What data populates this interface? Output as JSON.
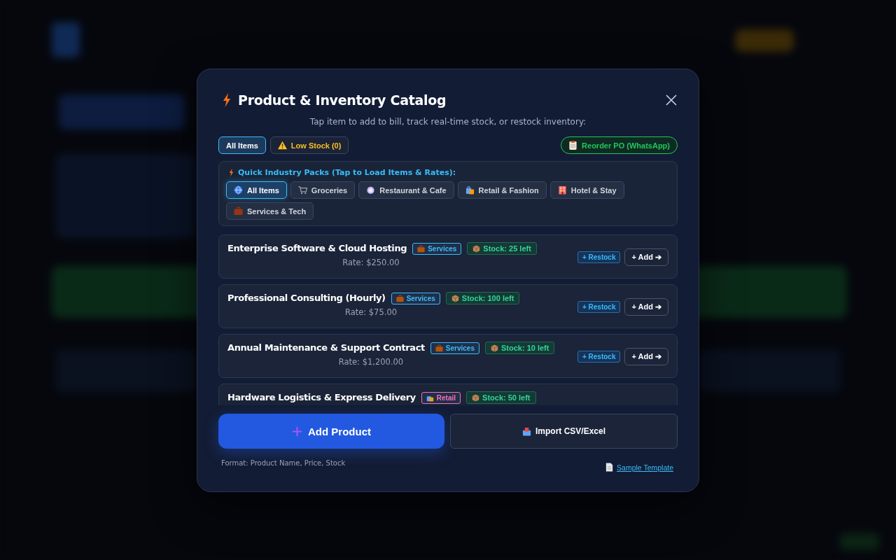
{
  "modal": {
    "title": "Product & Inventory Catalog",
    "subtitle": "Tap item to add to bill, track real-time stock, or restock inventory:"
  },
  "filters": [
    {
      "label": "All Items",
      "kind": "all",
      "selected": true
    },
    {
      "label": "Low Stock (0)",
      "kind": "low",
      "selected": false
    }
  ],
  "reorder_button": "Reorder PO (WhatsApp)",
  "packs": {
    "heading": "Quick Industry Packs (Tap to Load Items & Rates):",
    "items": [
      {
        "label": "All Items",
        "kind": "globe",
        "selected": true
      },
      {
        "label": "Groceries",
        "kind": "cart",
        "selected": false
      },
      {
        "label": "Restaurant & Cafe",
        "kind": "plate",
        "selected": false
      },
      {
        "label": "Retail & Fashion",
        "kind": "bags",
        "selected": false
      },
      {
        "label": "Hotel & Stay",
        "kind": "hotel",
        "selected": false
      },
      {
        "label": "Services & Tech",
        "kind": "briefcase",
        "selected": false
      }
    ]
  },
  "products": [
    {
      "name": "Enterprise Software & Cloud Hosting",
      "tag": {
        "label": "Services",
        "kind": "briefcase",
        "color": "#38bdf8"
      },
      "stock": "Stock: 25 left",
      "rate": "Rate: $250.00",
      "restock": "+ Restock",
      "add": "+ Add ➔"
    },
    {
      "name": "Professional Consulting (Hourly)",
      "tag": {
        "label": "Services",
        "kind": "briefcase",
        "color": "#38bdf8"
      },
      "stock": "Stock: 100 left",
      "rate": "Rate: $75.00",
      "restock": "+ Restock",
      "add": "+ Add ➔"
    },
    {
      "name": "Annual Maintenance & Support Contract",
      "tag": {
        "label": "Services",
        "kind": "briefcase",
        "color": "#38bdf8"
      },
      "stock": "Stock: 10 left",
      "rate": "Rate: $1,200.00",
      "restock": "+ Restock",
      "add": "+ Add ➔"
    },
    {
      "name": "Hardware Logistics & Express Delivery",
      "tag": {
        "label": "Retail",
        "kind": "bags",
        "color": "#f472b6"
      },
      "stock": "Stock: 50 left"
    }
  ],
  "add_product_button": "Add Product",
  "import_button": "Import CSV/Excel",
  "format_note": "Format: Product Name, Price, Stock",
  "template_link": "Sample Template"
}
